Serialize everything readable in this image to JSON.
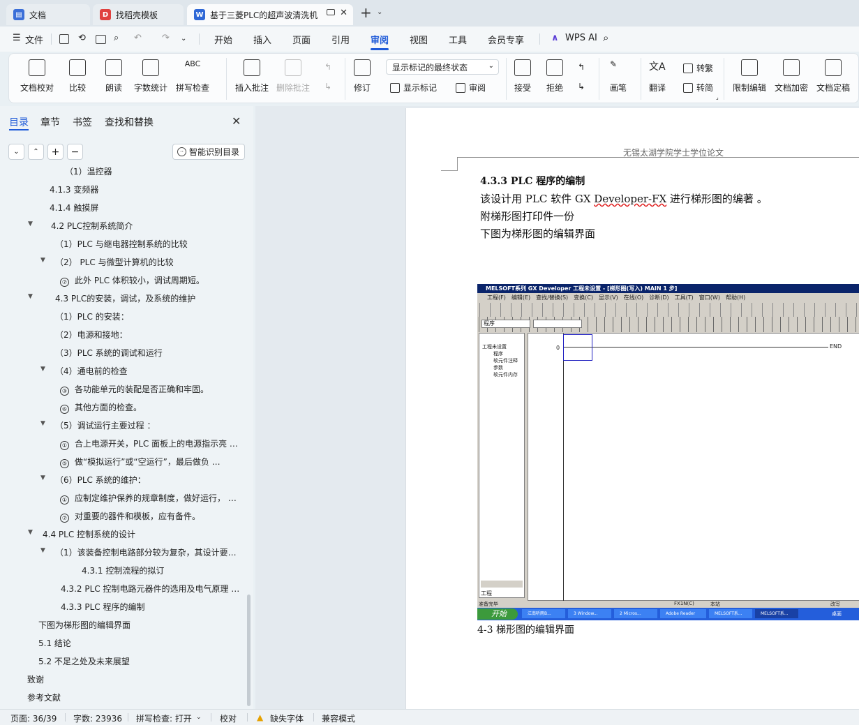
{
  "tabs": [
    {
      "label": "文档",
      "icon": "docs-icon"
    },
    {
      "label": "找稻壳模板",
      "icon": "daoke-icon"
    },
    {
      "label": "基于三菱PLC的超声波清洗机",
      "icon": "word-icon"
    }
  ],
  "menu": {
    "file": "文件",
    "items": [
      "开始",
      "插入",
      "页面",
      "引用",
      "审阅",
      "视图",
      "工具",
      "会员专享"
    ],
    "active": "审阅",
    "wps_ai": "WPS AI"
  },
  "ribbon": {
    "proofread": "文档校对",
    "compare": "比较",
    "read_aloud": "朗读",
    "word_count": "字数统计",
    "spell_check": "拼写检查",
    "insert_comment": "插入批注",
    "delete_comment": "删除批注",
    "markup_state": "显示标记的最终状态",
    "revise": "修订",
    "show_markup": "显示标记",
    "review": "审阅",
    "accept": "接受",
    "reject": "拒绝",
    "pen": "画笔",
    "translate": "翻译",
    "to_traditional": "转繁",
    "to_simplified": "转简",
    "restrict_edit": "限制编辑",
    "encrypt": "文档加密",
    "finalize": "文档定稿"
  },
  "panel": {
    "tabs": [
      "目录",
      "章节",
      "书签",
      "查找和替换"
    ],
    "smart_toc": "智能识别目录",
    "toc": [
      {
        "t": "（1）温控器",
        "i": 93,
        "a": ""
      },
      {
        "t": "4.1.3  变频器",
        "i": 71,
        "a": ""
      },
      {
        "t": "4.1.4  触摸屏",
        "i": 71,
        "a": ""
      },
      {
        "t": "4.2    PLC控制系统简介",
        "i": 73,
        "a": "▼"
      },
      {
        "t": "（1）PLC 与继电器控制系统的比较",
        "i": 79,
        "a": ""
      },
      {
        "t": "（2）   PLC 与微型计算机的比较",
        "i": 79,
        "a": "▼"
      },
      {
        "t": "此外 PLC 体积较小，调试周期短。",
        "i": 86,
        "a": "",
        "c": "⑦"
      },
      {
        "t": "4.3    PLC的安装，调试，及系统的维护",
        "i": 79,
        "a": "▼"
      },
      {
        "t": "（1）PLC 的安装：",
        "i": 79,
        "a": ""
      },
      {
        "t": "（2）电源和接地：",
        "i": 79,
        "a": ""
      },
      {
        "t": "（3）PLC 系统的调试和运行",
        "i": 79,
        "a": ""
      },
      {
        "t": "（4）通电前的检查",
        "i": 79,
        "a": "▼"
      },
      {
        "t": "各功能单元的装配是否正确和牢固。",
        "i": 86,
        "a": "",
        "c": "③"
      },
      {
        "t": "其他方面的检查。",
        "i": 86,
        "a": "",
        "c": "⑥"
      },
      {
        "t": "（5）调试运行主要过程 ：",
        "i": 79,
        "a": "▼"
      },
      {
        "t": "合上电源开关，PLC 面板上的电源指示亮 …",
        "i": 86,
        "a": "",
        "c": "①"
      },
      {
        "t": "做“模拟运行”或“空运行”，最后做负 …",
        "i": 86,
        "a": "",
        "c": "⑤"
      },
      {
        "t": "（6）PLC 系统的维护：",
        "i": 79,
        "a": "▼"
      },
      {
        "t": "应制定维护保养的规章制度，做好运行， …",
        "i": 86,
        "a": "",
        "c": "①"
      },
      {
        "t": "对重要的器件和模板，应有备件。",
        "i": 86,
        "a": "",
        "c": "⑦"
      },
      {
        "t": "4.4    PLC 控制系统的设计",
        "i": 61,
        "a": "▼"
      },
      {
        "t": "（1）该装备控制电路部分较为复杂，其设计要点 …",
        "i": 79,
        "a": "▼"
      },
      {
        "t": "4.3.1  控制流程的拟订",
        "i": 117,
        "a": ""
      },
      {
        "t": "4.3.2 PLC 控制电路元器件的选用及电气原理 …",
        "i": 87,
        "a": ""
      },
      {
        "t": "4.3.3 PLC 程序的编制",
        "i": 87,
        "a": ""
      },
      {
        "t": "下图为梯形图的编辑界面",
        "i": 55,
        "a": ""
      },
      {
        "t": "5.1  结论",
        "i": 55,
        "a": ""
      },
      {
        "t": "5.2  不足之处及未来展望",
        "i": 55,
        "a": ""
      },
      {
        "t": "致谢",
        "i": 39,
        "a": ""
      },
      {
        "t": "参考文献",
        "i": 39,
        "a": ""
      }
    ]
  },
  "doc": {
    "header": "无锡太湖学院学士学位论文",
    "heading": "4.3.3  PLC 程序的编制",
    "p1a": "该设计用 PLC 软件 GX ",
    "p1b": "Developer-FX",
    "p1c": " 进行梯形图的编著 。",
    "p2": "附梯形图打印件一份",
    "p3": "下图为梯形图的编辑界面",
    "caption": "4-3 梯形图的编辑界面"
  },
  "gx": {
    "title": "MELSOFT系列 GX Developer 工程未设置 - [梯形图(写入)      MAIN     1 步]",
    "menus": [
      "工程(F)",
      "编辑(E)",
      "查找/替换(S)",
      "变换(C)",
      "显示(V)",
      "在线(O)",
      "诊断(D)",
      "工具(T)",
      "窗口(W)",
      "帮助(H)"
    ],
    "combo": "程序",
    "tree": [
      "工程未设置",
      "程序",
      "软元件注释",
      "参数",
      "软元件内存"
    ],
    "tree_tab": "工程",
    "step": "0",
    "end": "END",
    "status": [
      "准备完毕",
      "FX1N(C)",
      "本站",
      "改写"
    ],
    "start": "开始",
    "taskbar": [
      "江南听雨B...",
      "3 Window...",
      "2 Micros...",
      "Adobe Reader",
      "MELSOFT系...",
      "MELSOFT系..."
    ],
    "desktop": "桌面"
  },
  "status": {
    "page": "页面: 36/39",
    "words": "字数: 23936",
    "spell": "拼写检查: 打开",
    "proof": "校对",
    "missing_font": "缺失字体",
    "compat": "兼容模式"
  }
}
